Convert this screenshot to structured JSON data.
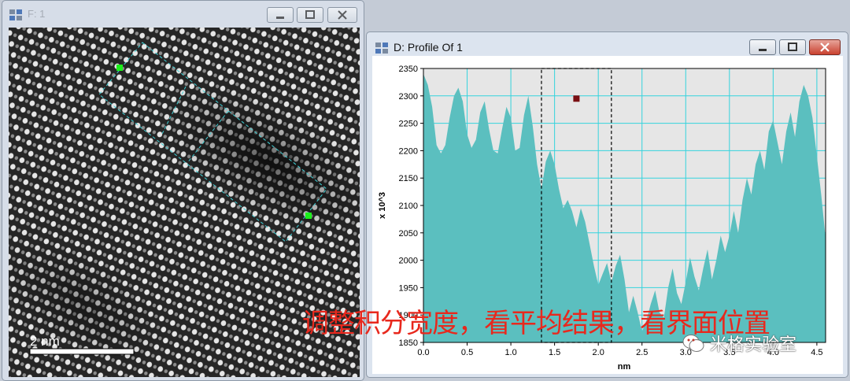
{
  "left_window": {
    "title": "F: 1",
    "scale_bar_label": "2 nm"
  },
  "right_window": {
    "title": "D: Profile Of 1"
  },
  "chart_data": {
    "type": "area",
    "title": "",
    "xlabel": "nm",
    "ylabel": "x 10^3",
    "xlim": [
      0.0,
      4.6
    ],
    "ylim": [
      1850,
      2350
    ],
    "grid": true,
    "color": "#5bbfbf",
    "x_ticks": [
      "0.0",
      "0.5",
      "1.0",
      "1.5",
      "2.0",
      "2.5",
      "3.0",
      "3.5",
      "4.0",
      "4.5"
    ],
    "y_ticks": [
      "1850",
      "1900",
      "1950",
      "2000",
      "2050",
      "2100",
      "2150",
      "2200",
      "2250",
      "2300",
      "2350"
    ],
    "selection": {
      "x_start": 1.35,
      "x_end": 2.15
    },
    "marker": {
      "x": 1.75,
      "y": 2295
    },
    "series": [
      {
        "x": [
          0.0,
          0.05,
          0.1,
          0.15,
          0.2,
          0.25,
          0.3,
          0.35,
          0.4,
          0.45,
          0.5,
          0.55,
          0.6,
          0.65,
          0.7,
          0.75,
          0.8,
          0.85,
          0.9,
          0.95,
          1.0,
          1.05,
          1.1,
          1.15,
          1.2,
          1.25,
          1.3,
          1.35,
          1.4,
          1.45,
          1.5,
          1.55,
          1.6,
          1.65,
          1.7,
          1.75,
          1.8,
          1.85,
          1.9,
          1.95,
          2.0,
          2.05,
          2.1,
          2.15,
          2.2,
          2.25,
          2.3,
          2.35,
          2.4,
          2.45,
          2.5,
          2.55,
          2.6,
          2.65,
          2.7,
          2.75,
          2.8,
          2.85,
          2.9,
          2.95,
          3.0,
          3.05,
          3.1,
          3.15,
          3.2,
          3.25,
          3.3,
          3.35,
          3.4,
          3.45,
          3.5,
          3.55,
          3.6,
          3.65,
          3.7,
          3.75,
          3.8,
          3.85,
          3.9,
          3.95,
          4.0,
          4.05,
          4.1,
          4.15,
          4.2,
          4.25,
          4.3,
          4.35,
          4.4,
          4.45,
          4.5,
          4.55,
          4.6
        ],
        "values": [
          2340,
          2320,
          2280,
          2210,
          2195,
          2210,
          2260,
          2300,
          2315,
          2290,
          2230,
          2205,
          2220,
          2270,
          2290,
          2240,
          2200,
          2195,
          2240,
          2280,
          2260,
          2200,
          2205,
          2265,
          2300,
          2245,
          2175,
          2130,
          2180,
          2200,
          2175,
          2130,
          2095,
          2110,
          2090,
          2060,
          2095,
          2070,
          2030,
          1990,
          1955,
          1975,
          1995,
          1960,
          1990,
          2010,
          1965,
          1905,
          1935,
          1905,
          1870,
          1890,
          1920,
          1945,
          1905,
          1895,
          1950,
          1985,
          1940,
          1920,
          1960,
          2005,
          1970,
          1945,
          1985,
          2020,
          1965,
          2000,
          2045,
          2015,
          2045,
          2090,
          2050,
          2110,
          2150,
          2120,
          2175,
          2200,
          2165,
          2235,
          2255,
          2215,
          2175,
          2235,
          2270,
          2225,
          2290,
          2320,
          2300,
          2260,
          2190,
          2120,
          2040
        ]
      }
    ]
  },
  "caption": "调整积分宽度，看平均结果，看界面位置",
  "watermark": "米格实验室"
}
